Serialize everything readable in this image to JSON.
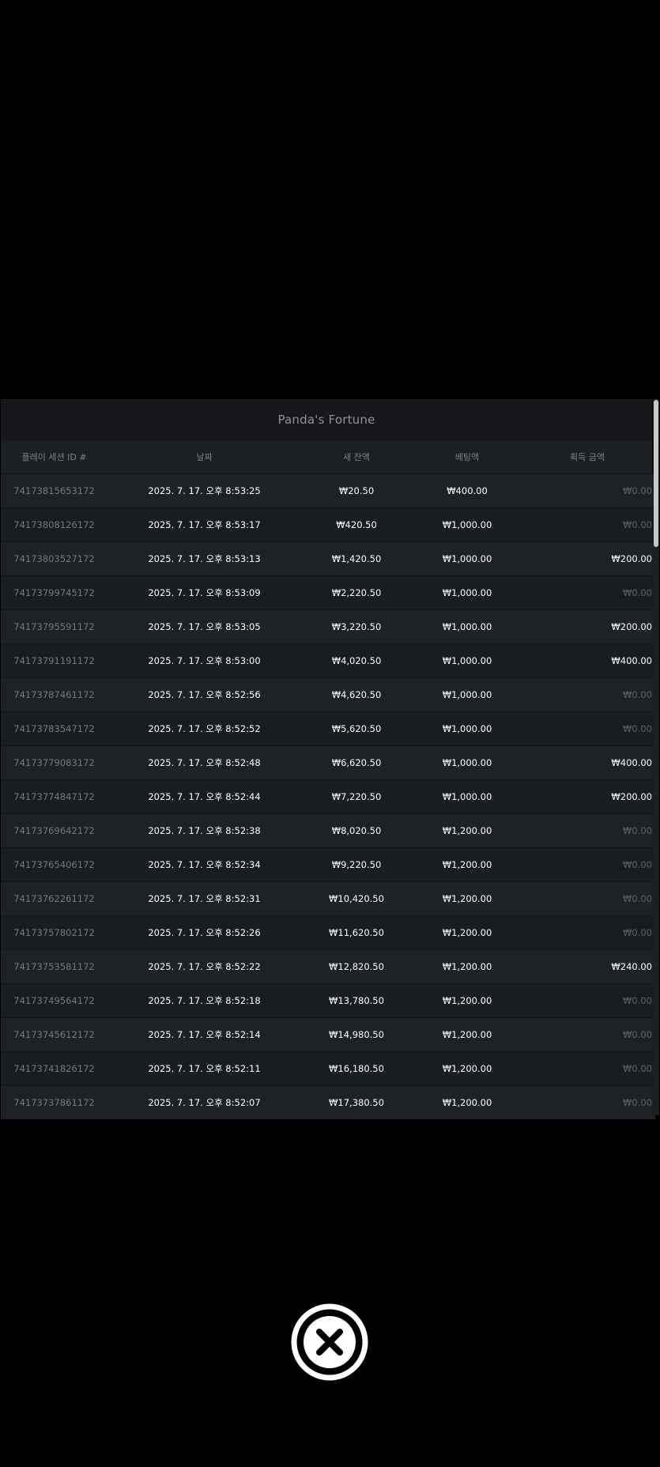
{
  "dialog": {
    "title": "Panda's Fortune"
  },
  "table": {
    "headers": {
      "session_id": "플레이 세션 ID #",
      "date": "날짜",
      "new_balance": "새 잔액",
      "bet_amount": "베팅액",
      "win_amount": "획득 금액"
    },
    "rows": [
      {
        "id": "74173815653172",
        "date": "2025. 7. 17. 오후 8:53:25",
        "balance": "₩20.50",
        "bet": "₩400.00",
        "win": "₩0.00",
        "win_zero": true
      },
      {
        "id": "74173808126172",
        "date": "2025. 7. 17. 오후 8:53:17",
        "balance": "₩420.50",
        "bet": "₩1,000.00",
        "win": "₩0.00",
        "win_zero": true
      },
      {
        "id": "74173803527172",
        "date": "2025. 7. 17. 오후 8:53:13",
        "balance": "₩1,420.50",
        "bet": "₩1,000.00",
        "win": "₩200.00",
        "win_zero": false
      },
      {
        "id": "74173799745172",
        "date": "2025. 7. 17. 오후 8:53:09",
        "balance": "₩2,220.50",
        "bet": "₩1,000.00",
        "win": "₩0.00",
        "win_zero": true
      },
      {
        "id": "74173795591172",
        "date": "2025. 7. 17. 오후 8:53:05",
        "balance": "₩3,220.50",
        "bet": "₩1,000.00",
        "win": "₩200.00",
        "win_zero": false
      },
      {
        "id": "74173791191172",
        "date": "2025. 7. 17. 오후 8:53:00",
        "balance": "₩4,020.50",
        "bet": "₩1,000.00",
        "win": "₩400.00",
        "win_zero": false
      },
      {
        "id": "74173787461172",
        "date": "2025. 7. 17. 오후 8:52:56",
        "balance": "₩4,620.50",
        "bet": "₩1,000.00",
        "win": "₩0.00",
        "win_zero": true
      },
      {
        "id": "74173783547172",
        "date": "2025. 7. 17. 오후 8:52:52",
        "balance": "₩5,620.50",
        "bet": "₩1,000.00",
        "win": "₩0.00",
        "win_zero": true
      },
      {
        "id": "74173779083172",
        "date": "2025. 7. 17. 오후 8:52:48",
        "balance": "₩6,620.50",
        "bet": "₩1,000.00",
        "win": "₩400.00",
        "win_zero": false
      },
      {
        "id": "74173774847172",
        "date": "2025. 7. 17. 오후 8:52:44",
        "balance": "₩7,220.50",
        "bet": "₩1,000.00",
        "win": "₩200.00",
        "win_zero": false
      },
      {
        "id": "74173769642172",
        "date": "2025. 7. 17. 오후 8:52:38",
        "balance": "₩8,020.50",
        "bet": "₩1,200.00",
        "win": "₩0.00",
        "win_zero": true
      },
      {
        "id": "74173765406172",
        "date": "2025. 7. 17. 오후 8:52:34",
        "balance": "₩9,220.50",
        "bet": "₩1,200.00",
        "win": "₩0.00",
        "win_zero": true
      },
      {
        "id": "74173762261172",
        "date": "2025. 7. 17. 오후 8:52:31",
        "balance": "₩10,420.50",
        "bet": "₩1,200.00",
        "win": "₩0.00",
        "win_zero": true
      },
      {
        "id": "74173757802172",
        "date": "2025. 7. 17. 오후 8:52:26",
        "balance": "₩11,620.50",
        "bet": "₩1,200.00",
        "win": "₩0.00",
        "win_zero": true
      },
      {
        "id": "74173753581172",
        "date": "2025. 7. 17. 오후 8:52:22",
        "balance": "₩12,820.50",
        "bet": "₩1,200.00",
        "win": "₩240.00",
        "win_zero": false
      },
      {
        "id": "74173749564172",
        "date": "2025. 7. 17. 오후 8:52:18",
        "balance": "₩13,780.50",
        "bet": "₩1,200.00",
        "win": "₩0.00",
        "win_zero": true
      },
      {
        "id": "74173745612172",
        "date": "2025. 7. 17. 오후 8:52:14",
        "balance": "₩14,980.50",
        "bet": "₩1,200.00",
        "win": "₩0.00",
        "win_zero": true
      },
      {
        "id": "74173741826172",
        "date": "2025. 7. 17. 오후 8:52:11",
        "balance": "₩16,180.50",
        "bet": "₩1,200.00",
        "win": "₩0.00",
        "win_zero": true
      },
      {
        "id": "74173737861172",
        "date": "2025. 7. 17. 오후 8:52:07",
        "balance": "₩17,380.50",
        "bet": "₩1,200.00",
        "win": "₩0.00",
        "win_zero": true
      }
    ]
  },
  "close_button": {
    "icon": "close-x-circle-icon"
  },
  "colors": {
    "background": "#000000",
    "panel": "#1d2023",
    "header": "#16181b",
    "muted_text": "#75797d",
    "primary_text": "#ffffff"
  }
}
